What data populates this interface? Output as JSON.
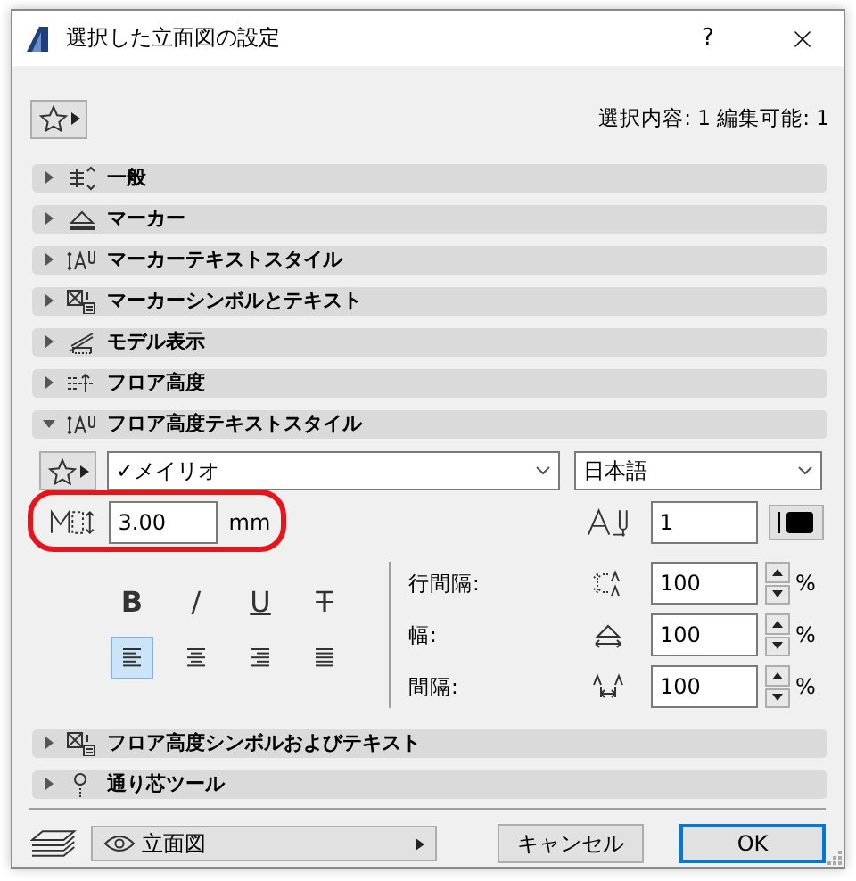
{
  "window": {
    "title": "選択した立面図の設定",
    "help": "?"
  },
  "selection_info": "選択内容: 1 編集可能: 1",
  "sections": [
    {
      "label": "一般",
      "kind": "general",
      "expanded": false
    },
    {
      "label": "マーカー",
      "kind": "marker",
      "expanded": false
    },
    {
      "label": "マーカーテキストスタイル",
      "kind": "text-style",
      "expanded": false
    },
    {
      "label": "マーカーシンボルとテキスト",
      "kind": "symbol-text",
      "expanded": false
    },
    {
      "label": "モデル表示",
      "kind": "model",
      "expanded": false
    },
    {
      "label": "フロア高度",
      "kind": "floor-level",
      "expanded": false
    },
    {
      "label": "フロア高度テキストスタイル",
      "kind": "text-style",
      "expanded": true
    },
    {
      "label": "フロア高度シンボルおよびテキスト",
      "kind": "symbol-text",
      "expanded": false
    },
    {
      "label": "通り芯ツール",
      "kind": "gridline",
      "expanded": false
    }
  ],
  "text_style_panel": {
    "font_mark": "✓",
    "font": "メイリオ",
    "language": "日本語",
    "size": "3.00",
    "size_unit": "mm",
    "pen": "1",
    "styles": [
      {
        "kind": "bold",
        "label": "B",
        "selected": false
      },
      {
        "kind": "italic",
        "label": "/",
        "selected": false
      },
      {
        "kind": "underline",
        "label": "U",
        "selected": false
      },
      {
        "kind": "strike",
        "label": "T",
        "selected": false
      }
    ],
    "alignments": [
      {
        "kind": "left",
        "selected": true
      },
      {
        "kind": "center",
        "selected": false
      },
      {
        "kind": "right",
        "selected": false
      },
      {
        "kind": "justify",
        "selected": false
      }
    ],
    "spacing": [
      {
        "label": "行間隔:",
        "kind": "line",
        "value": "100",
        "unit": "%"
      },
      {
        "label": "幅:",
        "kind": "width",
        "value": "100",
        "unit": "%"
      },
      {
        "label": "間隔:",
        "kind": "spacing",
        "value": "100",
        "unit": "%"
      }
    ]
  },
  "footer": {
    "view": "立面図",
    "cancel": "キャンセル",
    "ok": "OK"
  }
}
